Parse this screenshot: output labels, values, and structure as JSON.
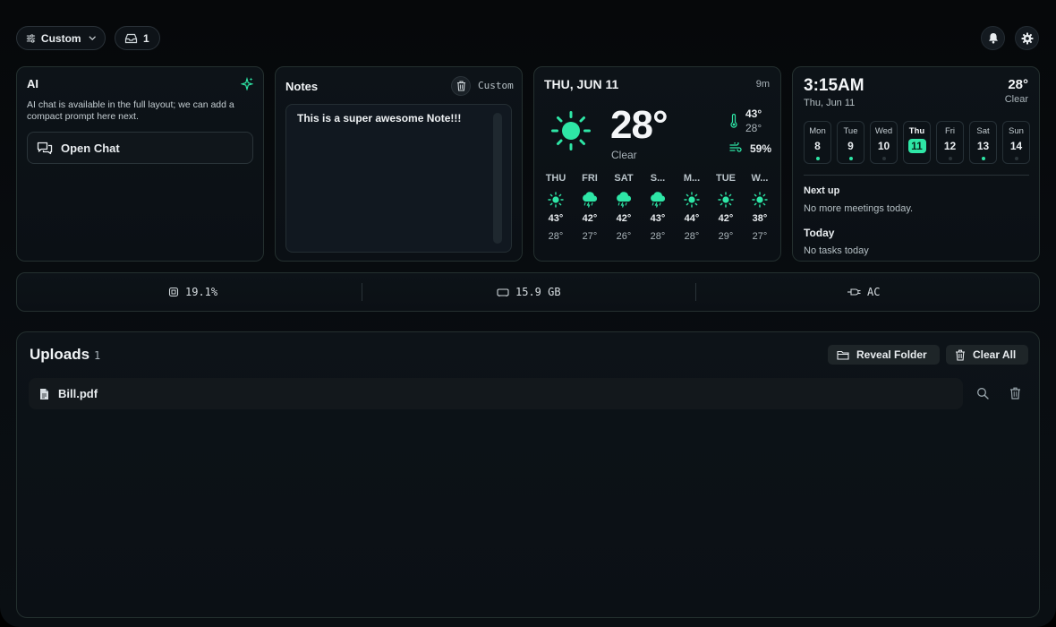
{
  "toolbar": {
    "layout_label": "Custom",
    "inbox_count": "1"
  },
  "ai": {
    "title": "AI",
    "description": "AI chat is available in the full layout; we can add a compact prompt here next.",
    "open_chat_label": "Open Chat"
  },
  "notes": {
    "title": "Notes",
    "mode_label": "Custom",
    "content": "This is a super awesome Note!!!"
  },
  "weather": {
    "date": "THU, JUN 11",
    "updated": "9m",
    "temperature": "28°",
    "condition": "Clear",
    "high": "43°",
    "low": "28°",
    "humidity": "59%",
    "forecast": [
      {
        "day": "THU",
        "icon": "sun-icon",
        "hi": "43°",
        "lo": "28°"
      },
      {
        "day": "FRI",
        "icon": "storm-cloud-icon",
        "hi": "42°",
        "lo": "27°"
      },
      {
        "day": "SAT",
        "icon": "storm-cloud-icon",
        "hi": "42°",
        "lo": "26°"
      },
      {
        "day": "S...",
        "icon": "storm-cloud-icon",
        "hi": "43°",
        "lo": "28°"
      },
      {
        "day": "M...",
        "icon": "sun-icon",
        "hi": "44°",
        "lo": "28°"
      },
      {
        "day": "TUE",
        "icon": "sun-icon",
        "hi": "42°",
        "lo": "29°"
      },
      {
        "day": "W...",
        "icon": "sun-icon",
        "hi": "38°",
        "lo": "27°"
      }
    ]
  },
  "calendar": {
    "time": "3:15AM",
    "date": "Thu, Jun 11",
    "temperature": "28°",
    "condition": "Clear",
    "days": [
      {
        "wd": "Mon",
        "num": "8",
        "dot": "active"
      },
      {
        "wd": "Tue",
        "num": "9",
        "dot": "active"
      },
      {
        "wd": "Wed",
        "num": "10",
        "dot": "dim"
      },
      {
        "wd": "Thu",
        "num": "11",
        "dot": "none",
        "selected": true
      },
      {
        "wd": "Fri",
        "num": "12",
        "dot": "dim"
      },
      {
        "wd": "Sat",
        "num": "13",
        "dot": "active"
      },
      {
        "wd": "Sun",
        "num": "14",
        "dot": "dim"
      }
    ],
    "next_up_label": "Next up",
    "next_up_text": "No more meetings today.",
    "today_label": "Today",
    "today_text": "No tasks today"
  },
  "stats": {
    "cpu": "19.1%",
    "memory": "15.9 GB",
    "power": "AC"
  },
  "uploads": {
    "title": "Uploads",
    "count": "1",
    "reveal_label": "Reveal Folder",
    "clear_label": "Clear All",
    "files": [
      {
        "name": "Bill.pdf"
      }
    ]
  },
  "colors": {
    "accent": "#2ee6a6",
    "background": "#0a0f13",
    "card_border": "#24302f"
  }
}
